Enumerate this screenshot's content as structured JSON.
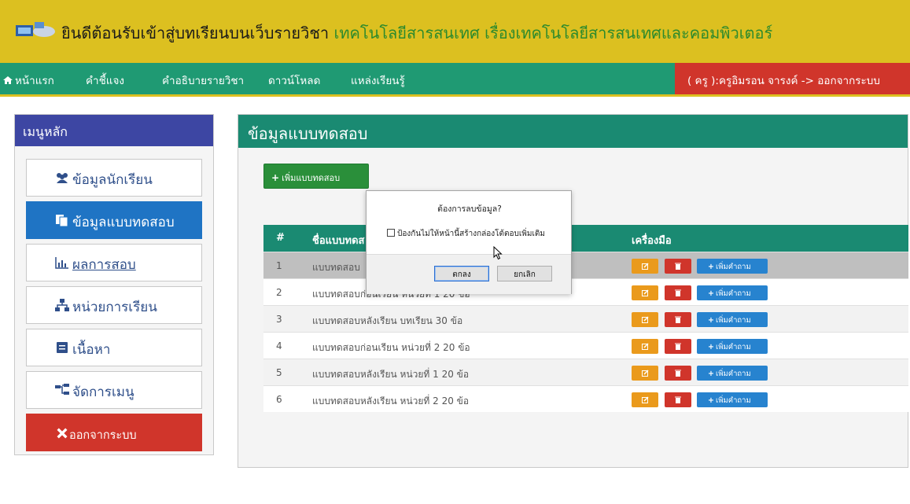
{
  "header": {
    "welcome": "ยินดีต้อนรับเข้าสู่บทเรียนบนเว็บรายวิชา ",
    "subject": "เทคโนโลยีสารสนเทศ เรื่องเทคโนโลยีสารสนเทศและคอมพิวเตอร์"
  },
  "nav": {
    "items": [
      "หน้าแรก",
      "คำชี้แจง",
      "คำอธิบายรายวิชา",
      "ดาวน์โหลด",
      "แหล่งเรียนรู้"
    ],
    "user": "( ครู ):ครูอิมรอน จารงค์ -> ออกจากระบบ"
  },
  "sidebar": {
    "title": "เมนูหลัก",
    "items": [
      {
        "label": "ข้อมูลนักเรียน",
        "icon": "users-icon"
      },
      {
        "label": "ข้อมูลแบบทดสอบ",
        "icon": "copy-icon"
      },
      {
        "label": "ผลการสอบ",
        "icon": "bar-chart-icon"
      },
      {
        "label": "หน่วยการเรียน",
        "icon": "sitemap-icon"
      },
      {
        "label": "เนื้อหา",
        "icon": "book-icon"
      },
      {
        "label": "จัดการเมนู",
        "icon": "hierarchy-icon"
      },
      {
        "label": "ออกจากระบบ",
        "icon": "close-icon"
      }
    ]
  },
  "panel": {
    "title": "ข้อมูลแบบทดสอบ",
    "add_button": "เพิ่มแบบทดสอบ"
  },
  "table": {
    "columns": [
      "#",
      "ชื่อแบบทดส",
      "เครื่องมือ"
    ],
    "add_question_label": "เพิ่มคำถาม",
    "rows": [
      {
        "num": "1",
        "name": "แบบทดสอบ"
      },
      {
        "num": "2",
        "name": "แบบทดสอบก่อนเรียน หน่วยที่ 1 20 ข้อ"
      },
      {
        "num": "3",
        "name": "แบบทดสอบหลังเรียน บทเรียน 30 ข้อ"
      },
      {
        "num": "4",
        "name": "แบบทดสอบก่อนเรียน หน่วยที่ 2 20 ข้อ"
      },
      {
        "num": "5",
        "name": "แบบทดสอบหลังเรียน หน่วยที่ 1 20 ข้อ"
      },
      {
        "num": "6",
        "name": "แบบทดสอบหลังเรียน หน่วยที่ 2 20 ข้อ"
      }
    ]
  },
  "dialog": {
    "message": "ต้องการลบข้อมูล?",
    "checkbox_label": "ป้องกันไม่ให้หน้านี้สร้างกล่องโต้ตอบเพิ่มเติม",
    "ok": "ตกลง",
    "cancel": "ยกเลิก"
  }
}
